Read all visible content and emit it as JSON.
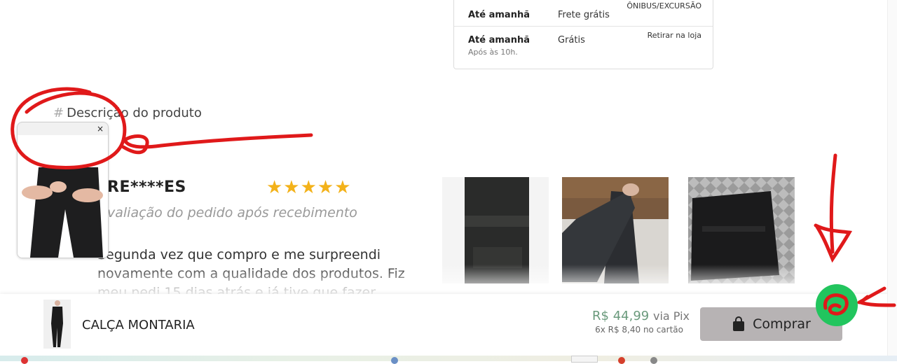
{
  "shipping": {
    "rows": [
      {
        "when": "Até amanhã",
        "sub": "",
        "price": "Frete grátis",
        "type": "ÔNIBUS/EXCURSÃO"
      },
      {
        "when": "Até amanhã",
        "sub": "Após às 10h.",
        "price": "Grátis",
        "type": "Retirar na loja"
      }
    ]
  },
  "description": {
    "hash": "#",
    "heading": "Descrição do produto"
  },
  "popup": {
    "close_label": "×"
  },
  "review": {
    "name": "RE****ES",
    "stars": "★★★★★",
    "rating": 5,
    "subtitle": "valiação do pedido após recebimento",
    "body": "Segunda vez que compro e me surpreendi novamente com a qualidade dos produtos. Fiz meu pedi 15 dias atrás e já tive que fazer"
  },
  "bottom_bar": {
    "product_name": "CALÇA MONTARIA",
    "price_pix": "R$ 44,99",
    "via_pix": "via Pix",
    "installments": "6x R$ 8,40 no cartão",
    "buy_label": "Comprar"
  },
  "colors": {
    "accent_price": "#6a9a7c",
    "stars": "#f3b21a",
    "annotation_red": "#e0191a",
    "highlight_green": "#22c55e",
    "buy_button": "#b7b3b4"
  },
  "icons": {
    "bag": "shopping-bag-icon",
    "close": "close-icon"
  }
}
